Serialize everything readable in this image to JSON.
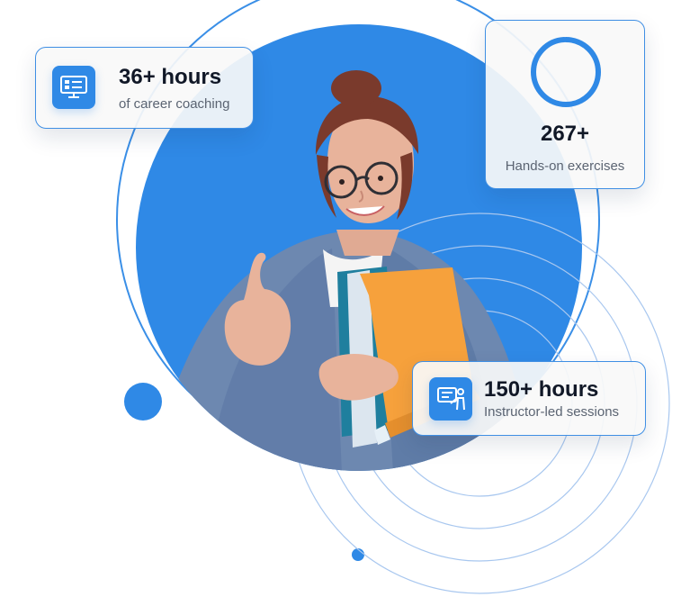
{
  "cards": {
    "coaching": {
      "title": "36+ hours",
      "subtitle": "of career coaching",
      "icon": "presentation-board-icon"
    },
    "exercises": {
      "title": "267+",
      "subtitle": "Hands-on exercises",
      "progress": 0.99,
      "icon": "progress-ring-icon"
    },
    "instructor": {
      "title": "150+ hours",
      "subtitle": "Instructor-led sessions",
      "icon": "instructor-board-icon"
    }
  },
  "colors": {
    "accent_blue": "#2f89e6",
    "light_blue_line": "#a8c7ef",
    "card_border": "#3f8fe4",
    "shirt_blue": "#6d88b0",
    "folder_orange": "#f6a13c",
    "skin": "#e8b39b",
    "hair": "#7a3a2c"
  },
  "image": {
    "subject": "smiling student holding folders"
  }
}
